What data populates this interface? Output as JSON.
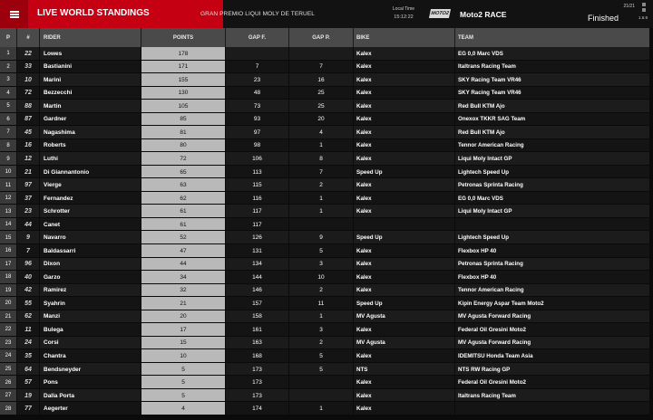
{
  "header": {
    "title": "LIVE WORLD STANDINGS",
    "event": "GRAN PREMIO LIQUI MOLY DE TERUEL",
    "local_time_label": "Local Time",
    "local_time": "15:12:22",
    "category_logo": "MOTO2",
    "race": "Moto2 RACE",
    "lap_count": "21/21",
    "status": "Finished",
    "version": "1.6.9",
    "menu_icon": "hamburger-menu-icon"
  },
  "columns": {
    "pos": "P",
    "number": "#",
    "rider": "RIDER",
    "points": "POINTS",
    "gap_first": "GAP F.",
    "gap_prev": "GAP P.",
    "bike": "BIKE",
    "team": "TEAM"
  },
  "rows": [
    {
      "pos": "1",
      "num": "22",
      "rider": "Lowes",
      "points": "178",
      "gap_f": "",
      "gap_p": "",
      "bike": "Kalex",
      "team": "EG 0,0 Marc VDS"
    },
    {
      "pos": "2",
      "num": "33",
      "rider": "Bastianini",
      "points": "171",
      "gap_f": "7",
      "gap_p": "7",
      "bike": "Kalex",
      "team": "Italtrans Racing Team"
    },
    {
      "pos": "3",
      "num": "10",
      "rider": "Marini",
      "points": "155",
      "gap_f": "23",
      "gap_p": "16",
      "bike": "Kalex",
      "team": "SKY Racing Team VR46"
    },
    {
      "pos": "4",
      "num": "72",
      "rider": "Bezzecchi",
      "points": "130",
      "gap_f": "48",
      "gap_p": "25",
      "bike": "Kalex",
      "team": "SKY Racing Team VR46"
    },
    {
      "pos": "5",
      "num": "88",
      "rider": "Martin",
      "points": "105",
      "gap_f": "73",
      "gap_p": "25",
      "bike": "Kalex",
      "team": "Red Bull KTM Ajo"
    },
    {
      "pos": "6",
      "num": "87",
      "rider": "Gardner",
      "points": "85",
      "gap_f": "93",
      "gap_p": "20",
      "bike": "Kalex",
      "team": "Onexox TKKR SAG Team"
    },
    {
      "pos": "7",
      "num": "45",
      "rider": "Nagashima",
      "points": "81",
      "gap_f": "97",
      "gap_p": "4",
      "bike": "Kalex",
      "team": "Red Bull KTM Ajo"
    },
    {
      "pos": "8",
      "num": "16",
      "rider": "Roberts",
      "points": "80",
      "gap_f": "98",
      "gap_p": "1",
      "bike": "Kalex",
      "team": "Tennor American Racing"
    },
    {
      "pos": "9",
      "num": "12",
      "rider": "Luthi",
      "points": "72",
      "gap_f": "106",
      "gap_p": "8",
      "bike": "Kalex",
      "team": "Liqui Moly Intact GP"
    },
    {
      "pos": "10",
      "num": "21",
      "rider": "Di Giannantonio",
      "points": "65",
      "gap_f": "113",
      "gap_p": "7",
      "bike": "Speed Up",
      "team": "Lightech Speed Up"
    },
    {
      "pos": "11",
      "num": "97",
      "rider": "Vierge",
      "points": "63",
      "gap_f": "115",
      "gap_p": "2",
      "bike": "Kalex",
      "team": "Petronas Sprinta Racing"
    },
    {
      "pos": "12",
      "num": "37",
      "rider": "Fernandez",
      "points": "62",
      "gap_f": "116",
      "gap_p": "1",
      "bike": "Kalex",
      "team": "EG 0,0 Marc VDS"
    },
    {
      "pos": "13",
      "num": "23",
      "rider": "Schrotter",
      "points": "61",
      "gap_f": "117",
      "gap_p": "1",
      "bike": "Kalex",
      "team": "Liqui Moly Intact GP"
    },
    {
      "pos": "14",
      "num": "44",
      "rider": "Canet",
      "points": "61",
      "gap_f": "117",
      "gap_p": "",
      "bike": "",
      "team": ""
    },
    {
      "pos": "15",
      "num": "9",
      "rider": "Navarro",
      "points": "52",
      "gap_f": "126",
      "gap_p": "9",
      "bike": "Speed Up",
      "team": "Lightech Speed Up"
    },
    {
      "pos": "16",
      "num": "7",
      "rider": "Baldassarri",
      "points": "47",
      "gap_f": "131",
      "gap_p": "5",
      "bike": "Kalex",
      "team": "Flexbox HP 40"
    },
    {
      "pos": "17",
      "num": "96",
      "rider": "Dixon",
      "points": "44",
      "gap_f": "134",
      "gap_p": "3",
      "bike": "Kalex",
      "team": "Petronas Sprinta Racing"
    },
    {
      "pos": "18",
      "num": "40",
      "rider": "Garzo",
      "points": "34",
      "gap_f": "144",
      "gap_p": "10",
      "bike": "Kalex",
      "team": "Flexbox HP 40"
    },
    {
      "pos": "19",
      "num": "42",
      "rider": "Ramirez",
      "points": "32",
      "gap_f": "146",
      "gap_p": "2",
      "bike": "Kalex",
      "team": "Tennor American Racing"
    },
    {
      "pos": "20",
      "num": "55",
      "rider": "Syahrin",
      "points": "21",
      "gap_f": "157",
      "gap_p": "11",
      "bike": "Speed Up",
      "team": "Kipin Energy Aspar Team Moto2"
    },
    {
      "pos": "21",
      "num": "62",
      "rider": "Manzi",
      "points": "20",
      "gap_f": "158",
      "gap_p": "1",
      "bike": "MV Agusta",
      "team": "MV Agusta Forward Racing"
    },
    {
      "pos": "22",
      "num": "11",
      "rider": "Bulega",
      "points": "17",
      "gap_f": "161",
      "gap_p": "3",
      "bike": "Kalex",
      "team": "Federal Oil Gresini Moto2"
    },
    {
      "pos": "23",
      "num": "24",
      "rider": "Corsi",
      "points": "15",
      "gap_f": "163",
      "gap_p": "2",
      "bike": "MV Agusta",
      "team": "MV Agusta Forward Racing"
    },
    {
      "pos": "24",
      "num": "35",
      "rider": "Chantra",
      "points": "10",
      "gap_f": "168",
      "gap_p": "5",
      "bike": "Kalex",
      "team": "IDEMITSU Honda Team Asia"
    },
    {
      "pos": "25",
      "num": "64",
      "rider": "Bendsneyder",
      "points": "5",
      "gap_f": "173",
      "gap_p": "5",
      "bike": "NTS",
      "team": "NTS RW Racing GP"
    },
    {
      "pos": "26",
      "num": "57",
      "rider": "Pons",
      "points": "5",
      "gap_f": "173",
      "gap_p": "",
      "bike": "Kalex",
      "team": "Federal Oil Gresini Moto2"
    },
    {
      "pos": "27",
      "num": "19",
      "rider": "Dalla Porta",
      "points": "5",
      "gap_f": "173",
      "gap_p": "",
      "bike": "Kalex",
      "team": "Italtrans Racing Team"
    },
    {
      "pos": "28",
      "num": "77",
      "rider": "Aegerter",
      "points": "4",
      "gap_f": "174",
      "gap_p": "1",
      "bike": "Kalex",
      "team": ""
    }
  ],
  "colors": {
    "brand_red": "#c40012",
    "header_bg": "#121212",
    "column_header_bg": "#4a4a4a",
    "points_cell_bg": "#b9b9b9"
  }
}
